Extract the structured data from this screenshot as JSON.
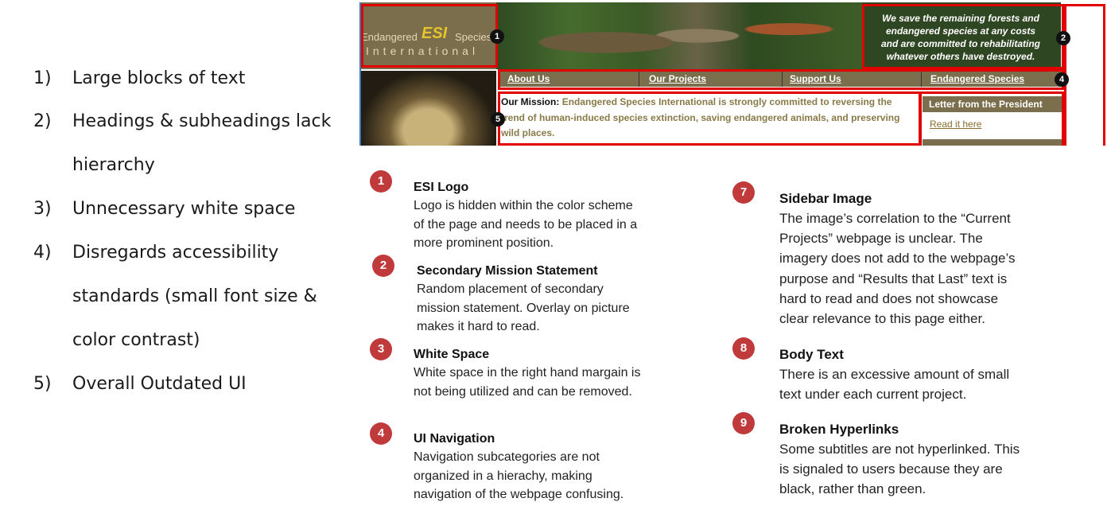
{
  "issues_list": [
    {
      "num": "1)",
      "text": "Large blocks of text"
    },
    {
      "num": "2)",
      "text": "Headings & subheadings lack"
    },
    {
      "num": "",
      "text": "hierarchy"
    },
    {
      "num": "3)",
      "text": "Unnecessary white space"
    },
    {
      "num": "4)",
      "text": "Disregards accessibility"
    },
    {
      "num": "",
      "text": "standards (small font size &"
    },
    {
      "num": "",
      "text": "color contrast)"
    },
    {
      "num": "5)",
      "text": "Overall Outdated UI"
    }
  ],
  "screenshot": {
    "logo": {
      "line1_left": "Endangered",
      "line1_mid": "ESI",
      "line1_right": "Species",
      "line2": "International"
    },
    "statement": [
      "We save the remaining forests and",
      "endangered species at any costs",
      "and are committed to rehabilitating",
      "whatever others have destroyed."
    ],
    "nav": [
      "About Us",
      "Our Projects",
      "Support Us",
      "Endangered Species"
    ],
    "mission_lead": "Our Mission:",
    "mission_text": "Endangered Species International is strongly committed to reversing the trend of human-induced species extinction, saving endangered animals, and preserving wild places.",
    "letter_title": "Letter from the President",
    "letter_link": "Read it here",
    "badges": [
      "1",
      "2",
      "4",
      "5"
    ]
  },
  "annotations": [
    {
      "num": "1",
      "title": "ESI Logo",
      "body": [
        "Logo is hidden within the color scheme",
        "of the page and needs to be placed in a",
        "more prominent position."
      ]
    },
    {
      "num": "2",
      "title": "Secondary Mission Statement",
      "body": [
        "Random placement of secondary",
        "mission statement. Overlay on picture",
        "makes it hard to read."
      ]
    },
    {
      "num": "3",
      "title": "White Space",
      "body": [
        "White space in the right hand margain is",
        "not being utilized and can be removed."
      ]
    },
    {
      "num": "4",
      "title": "UI Navigation",
      "body": [
        "Navigation subcategories are not",
        "organized in a hierachy, making",
        "navigation of the webpage confusing."
      ]
    },
    {
      "num": "7",
      "title": "Sidebar Image",
      "body": [
        "The image’s correlation to the “Current",
        "Projects” webpage is unclear. The",
        "imagery does not add to the webpage’s",
        "purpose and “Results that Last” text is",
        "hard to read and does not showcase",
        "clear relevance to this page either."
      ]
    },
    {
      "num": "8",
      "title": "Body Text",
      "body": [
        "There is an excessive amount of small",
        "text under each current project."
      ]
    },
    {
      "num": "9",
      "title": "Broken Hyperlinks",
      "body": [
        "Some subtitles are not hyperlinked. This",
        "is signaled to users because they are",
        "black, rather than green."
      ]
    }
  ]
}
